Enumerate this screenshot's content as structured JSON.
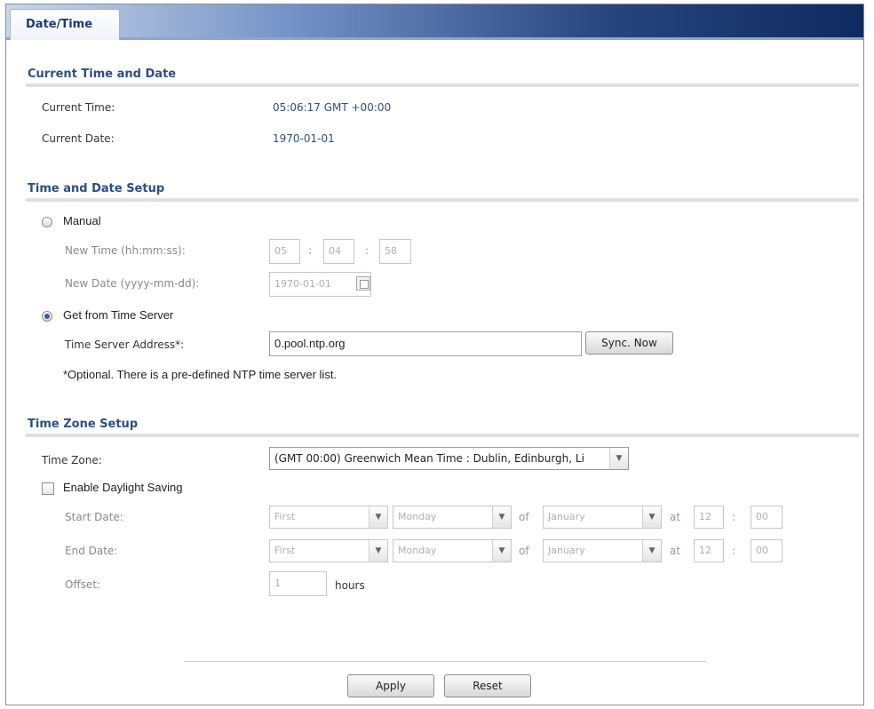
{
  "tab": {
    "label": "Date/Time"
  },
  "current": {
    "title": "Current Time and Date",
    "time_label": "Current Time:",
    "time_value": "05:06:17 GMT +00:00",
    "date_label": "Current Date:",
    "date_value": "1970-01-01"
  },
  "setup": {
    "title": "Time and Date Setup",
    "manual_label": "Manual",
    "new_time_label": "New Time (hh:mm:ss):",
    "hh": "05",
    "mm": "04",
    "ss": "58",
    "colon": ":",
    "new_date_label": "New Date (yyyy-mm-dd):",
    "new_date_value": "1970-01-01",
    "server_label": "Get from Time Server",
    "server_address_label": "Time Server Address*:",
    "server_address_value": "0.pool.ntp.org",
    "sync_label": "Sync. Now",
    "note": "*Optional. There is a pre-defined NTP time server list."
  },
  "tz": {
    "title": "Time Zone Setup",
    "zone_label": "Time Zone:",
    "zone_value": "(GMT 00:00) Greenwich Mean Time : Dublin, Edinburgh, Li",
    "dst_label": "Enable Daylight Saving",
    "start_label": "Start Date:",
    "end_label": "End Date:",
    "start": {
      "week": "First",
      "day": "Monday",
      "of": "of",
      "month": "January",
      "at": "at",
      "hour": "12",
      "min": "00"
    },
    "end": {
      "week": "First",
      "day": "Monday",
      "of": "of",
      "month": "January",
      "at": "at",
      "hour": "12",
      "min": "00"
    },
    "offset_label": "Offset:",
    "offset_value": "1",
    "hours_label": "hours"
  },
  "actions": {
    "apply": "Apply",
    "reset": "Reset"
  },
  "icons": {
    "dropdown": "chevron-down-icon",
    "calendar": "calendar-icon"
  }
}
